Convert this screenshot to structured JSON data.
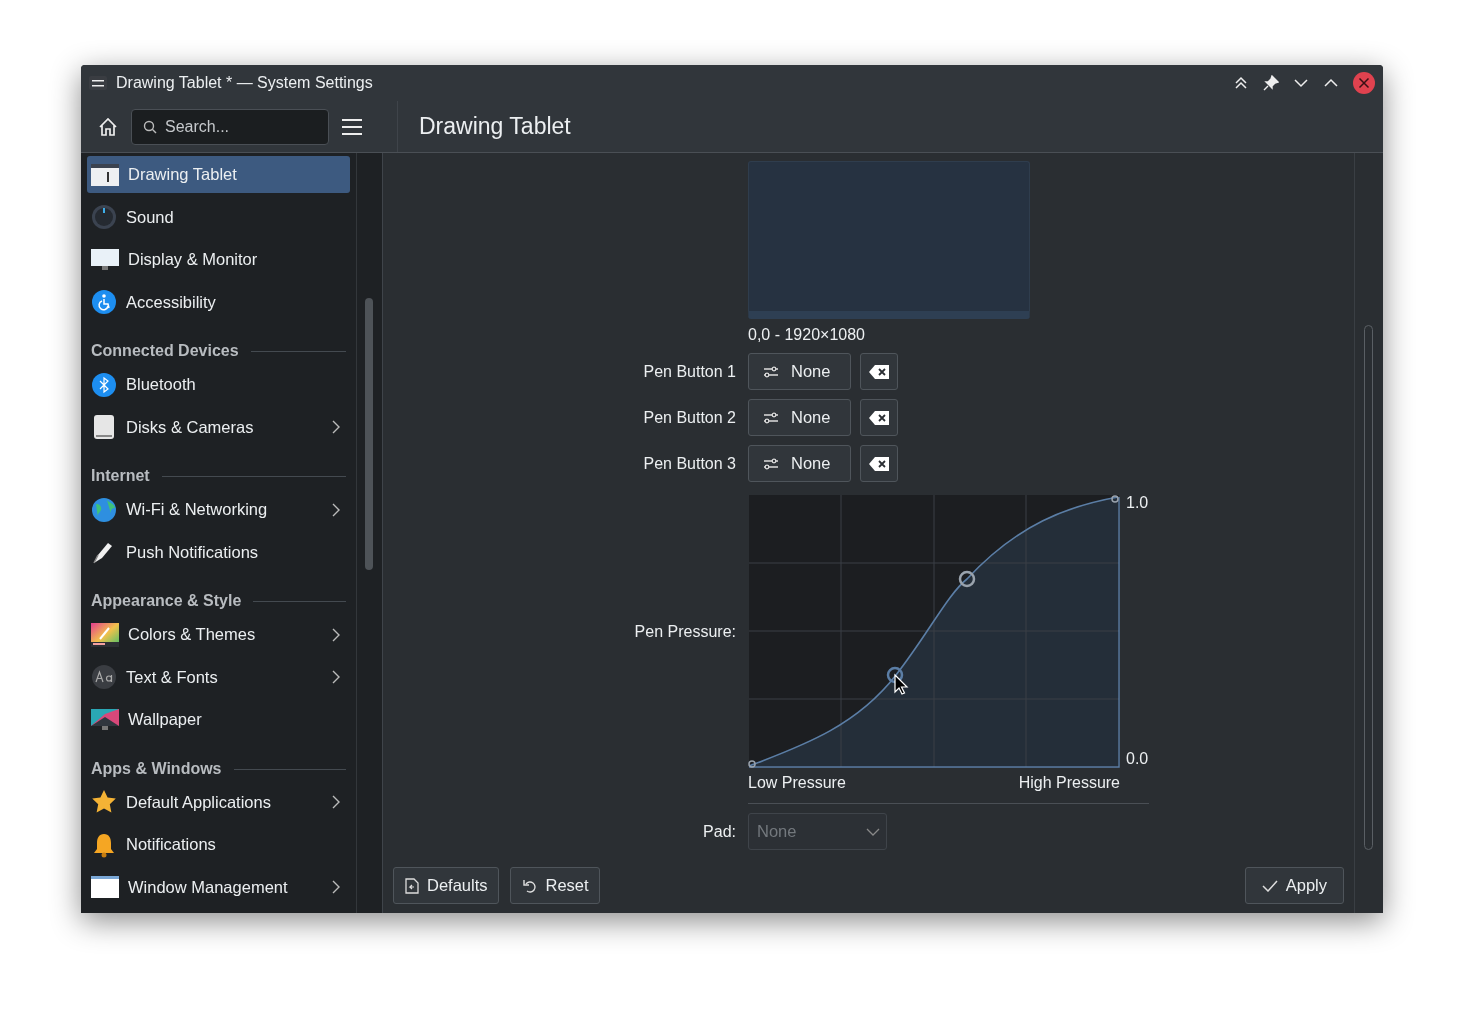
{
  "window": {
    "title": "Drawing Tablet * — System Settings"
  },
  "header": {
    "search": {
      "placeholder": "Search..."
    },
    "page_title": "Drawing Tablet"
  },
  "sidebar": {
    "items": [
      {
        "kind": "item",
        "label": "Drawing Tablet",
        "selected": true,
        "chevron": false
      },
      {
        "kind": "item",
        "label": "Sound",
        "selected": false,
        "chevron": false
      },
      {
        "kind": "item",
        "label": "Display & Monitor",
        "selected": false,
        "chevron": false
      },
      {
        "kind": "item",
        "label": "Accessibility",
        "selected": false,
        "chevron": false
      },
      {
        "kind": "section",
        "label": "Connected Devices"
      },
      {
        "kind": "item",
        "label": "Bluetooth",
        "selected": false,
        "chevron": false
      },
      {
        "kind": "item",
        "label": "Disks & Cameras",
        "selected": false,
        "chevron": true
      },
      {
        "kind": "section",
        "label": "Internet"
      },
      {
        "kind": "item",
        "label": "Wi-Fi & Networking",
        "selected": false,
        "chevron": true
      },
      {
        "kind": "item",
        "label": "Push Notifications",
        "selected": false,
        "chevron": false
      },
      {
        "kind": "section",
        "label": "Appearance & Style"
      },
      {
        "kind": "item",
        "label": "Colors & Themes",
        "selected": false,
        "chevron": true
      },
      {
        "kind": "item",
        "label": "Text & Fonts",
        "selected": false,
        "chevron": true
      },
      {
        "kind": "item",
        "label": "Wallpaper",
        "selected": false,
        "chevron": false
      },
      {
        "kind": "section",
        "label": "Apps & Windows"
      },
      {
        "kind": "item",
        "label": "Default Applications",
        "selected": false,
        "chevron": true
      },
      {
        "kind": "item",
        "label": "Notifications",
        "selected": false,
        "chevron": false
      },
      {
        "kind": "item",
        "label": "Window Management",
        "selected": false,
        "chevron": true
      }
    ]
  },
  "content": {
    "area_caption": "0,0 - 1920×1080",
    "pen_buttons": [
      {
        "label": "Pen Button 1",
        "value": "None"
      },
      {
        "label": "Pen Button 2",
        "value": "None"
      },
      {
        "label": "Pen Button 3",
        "value": "None"
      }
    ],
    "pressure": {
      "label": "Pen Pressure:",
      "max_label": "1.0",
      "min_label": "0.0",
      "low_label": "Low Pressure",
      "high_label": "High Pressure"
    },
    "pad": {
      "label": "Pad:",
      "value": "None",
      "disabled": true
    }
  },
  "footer": {
    "defaults": "Defaults",
    "reset": "Reset",
    "apply": "Apply"
  }
}
